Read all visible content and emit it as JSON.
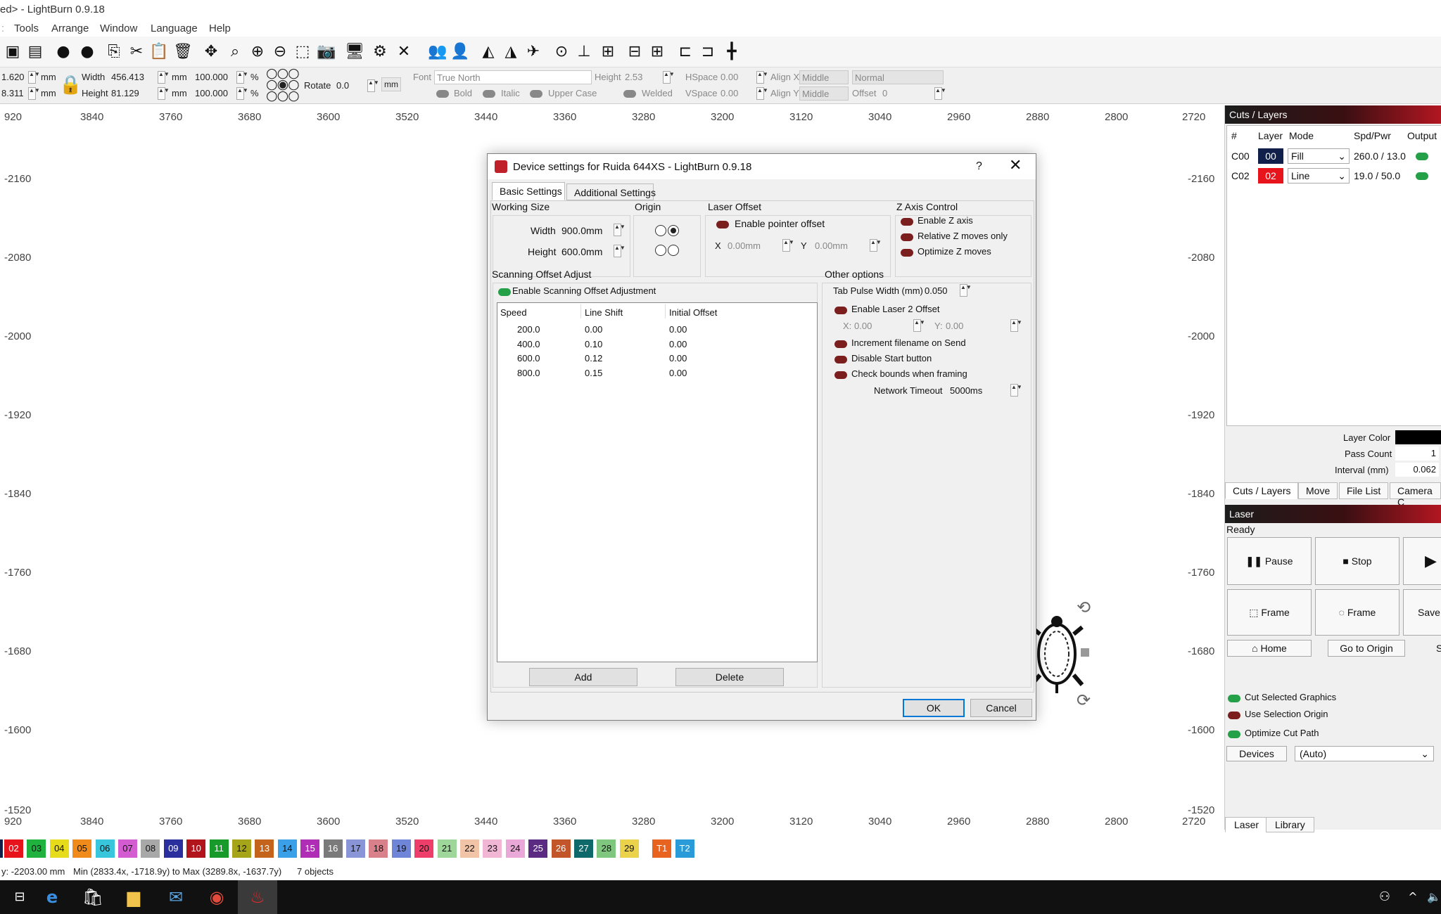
{
  "app": {
    "title": "ed> - LightBurn 0.9.18",
    "menu": [
      "Tools",
      "Arrange",
      "Window",
      "Language",
      "Help"
    ]
  },
  "propbar": {
    "x_value": "1.620",
    "y_value": "8.311",
    "unit_mm": "mm",
    "width_label": "Width",
    "width_value": "456.413",
    "height_label": "Height",
    "height_value": "81.129",
    "scale_w": "100.000",
    "scale_h": "100.000",
    "percent": "%",
    "rotate_label": "Rotate",
    "rotate_value": "0.0",
    "mm_button": "mm",
    "font_label": "Font",
    "font_value": "True North",
    "text_height_label": "Height",
    "text_height_value": "2.53",
    "hspace_label": "HSpace",
    "hspace_value": "0.00",
    "vspace_label": "VSpace",
    "vspace_value": "0.00",
    "alignx_label": "Align X",
    "alignx_value": "Middle",
    "aligny_label": "Align Y",
    "aligny_value": "Middle",
    "style_value": "Normal",
    "offset_label": "Offset",
    "offset_value": "0",
    "bold": "Bold",
    "italic": "Italic",
    "upper_case": "Upper Case",
    "welded": "Welded"
  },
  "ruler": {
    "top": [
      "920",
      "3840",
      "3760",
      "3680",
      "3600",
      "3520",
      "3440",
      "3360",
      "3280",
      "3200",
      "3120",
      "3040",
      "2960",
      "2880",
      "2800",
      "2720"
    ],
    "left": [
      "-2160",
      "-2080",
      "-2000",
      "-1920",
      "-1840",
      "-1760",
      "-1680",
      "-1600",
      "-1520"
    ]
  },
  "palette": [
    {
      "label": "02",
      "color": "#e8141c"
    },
    {
      "label": "03",
      "color": "#1fb23f"
    },
    {
      "label": "04",
      "color": "#e6dc1c"
    },
    {
      "label": "05",
      "color": "#f08a1a"
    },
    {
      "label": "06",
      "color": "#37c6dc"
    },
    {
      "label": "07",
      "color": "#d35cd0"
    },
    {
      "label": "08",
      "color": "#a8a8a8"
    },
    {
      "label": "09",
      "color": "#2b2f9e"
    },
    {
      "label": "10",
      "color": "#b2141c"
    },
    {
      "label": "11",
      "color": "#189a2a"
    },
    {
      "label": "12",
      "color": "#a6a51a"
    },
    {
      "label": "13",
      "color": "#c4631b"
    },
    {
      "label": "14",
      "color": "#3aa0e8"
    },
    {
      "label": "15",
      "color": "#b02db6"
    },
    {
      "label": "16",
      "color": "#7a7a7a"
    },
    {
      "label": "17",
      "color": "#8a95d8"
    },
    {
      "label": "18",
      "color": "#d9818b"
    },
    {
      "label": "19",
      "color": "#6f86d8"
    },
    {
      "label": "20",
      "color": "#ee3f6b"
    },
    {
      "label": "21",
      "color": "#9fd79a"
    },
    {
      "label": "22",
      "color": "#f2c4a7"
    },
    {
      "label": "23",
      "color": "#f0b6d4"
    },
    {
      "label": "24",
      "color": "#e9a8d8"
    },
    {
      "label": "25",
      "color": "#5b2a82"
    },
    {
      "label": "26",
      "color": "#c2562a"
    },
    {
      "label": "27",
      "color": "#0e6a6a"
    },
    {
      "label": "28",
      "color": "#7fc77e"
    },
    {
      "label": "29",
      "color": "#ead24a"
    },
    {
      "label": "T1",
      "color": "#e86320"
    },
    {
      "label": "T2",
      "color": "#2a9bd9"
    }
  ],
  "status": {
    "coords": "y: -2203.00 mm",
    "bounds": "Min (2833.4x, -1718.9y) to Max (3289.8x, -1637.7y)",
    "objects": "7 objects"
  },
  "right_panel": {
    "cuts_title": "Cuts / Layers",
    "columns": [
      "#",
      "Layer",
      "Mode",
      "Spd/Pwr",
      "Output"
    ],
    "rows": [
      {
        "num": "C00",
        "layer": "00",
        "color": "#10204a",
        "mode": "Fill",
        "spdpwr": "260.0 / 13.0"
      },
      {
        "num": "C02",
        "layer": "02",
        "color": "#e8141c",
        "mode": "Line",
        "spdpwr": "19.0 / 50.0"
      }
    ],
    "layer_color_label": "Layer Color",
    "pass_count_label": "Pass Count",
    "pass_count_value": "1",
    "interval_label": "Interval (mm)",
    "interval_value": "0.062",
    "tabs": [
      "Cuts / Layers",
      "Move",
      "File List",
      "Camera C"
    ],
    "laser_title": "Laser",
    "laser_status": "Ready",
    "pause": "Pause",
    "stop": "Stop",
    "frame1": "Frame",
    "frame2": "Frame",
    "save": "Save",
    "home": "Home",
    "go_to_origin": "Go to Origin",
    "st": "St",
    "cut_selected": "Cut Selected Graphics",
    "use_selection_origin": "Use Selection Origin",
    "optimize_cut_path": "Optimize Cut Path",
    "devices": "Devices",
    "device_value": "(Auto)",
    "bottom_tabs": [
      "Laser",
      "Library"
    ]
  },
  "dialog": {
    "title": "Device settings for Ruida 644XS - LightBurn 0.9.18",
    "help": "?",
    "tabs": [
      "Basic Settings",
      "Additional Settings"
    ],
    "working_size": "Working Size",
    "width_label": "Width",
    "width_value": "900.0mm",
    "height_label": "Height",
    "height_value": "600.0mm",
    "origin": "Origin",
    "laser_offset": "Laser Offset",
    "enable_pointer_offset": "Enable pointer offset",
    "x_label": "X",
    "x_value": "0.00mm",
    "y_label": "Y",
    "y_value": "0.00mm",
    "z_axis_control": "Z Axis Control",
    "enable_z": "Enable Z axis",
    "relative_z": "Relative Z moves only",
    "optimize_z": "Optimize Z moves",
    "scanning_offset_adjust": "Scanning Offset Adjust",
    "enable_scanning": "Enable Scanning Offset Adjustment",
    "table_headers": [
      "Speed",
      "Line Shift",
      "Initial Offset"
    ],
    "table_rows": [
      [
        "200.0",
        "0.00",
        "0.00"
      ],
      [
        "400.0",
        "0.10",
        "0.00"
      ],
      [
        "600.0",
        "0.12",
        "0.00"
      ],
      [
        "800.0",
        "0.15",
        "0.00"
      ]
    ],
    "add": "Add",
    "delete": "Delete",
    "other_options": "Other options",
    "tab_pulse_label": "Tab Pulse Width (mm)",
    "tab_pulse_value": "0.050",
    "enable_laser2": "Enable Laser 2 Offset",
    "x2_label": "X:",
    "x2_value": "0.00",
    "y2_label": "Y:",
    "y2_value": "0.00",
    "increment_filename": "Increment filename on Send",
    "disable_start": "Disable Start button",
    "check_bounds": "Check bounds when framing",
    "network_timeout_label": "Network Timeout",
    "network_timeout_value": "5000ms",
    "ok": "OK",
    "cancel": "Cancel"
  }
}
